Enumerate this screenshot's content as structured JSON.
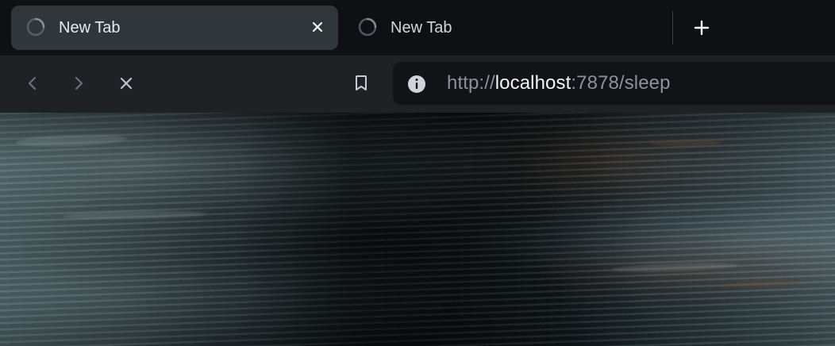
{
  "tabs": [
    {
      "title": "New Tab",
      "state": "active",
      "loading": true
    },
    {
      "title": "New Tab",
      "state": "inactive",
      "loading": true
    }
  ],
  "toolbar": {
    "address": {
      "scheme": "http://",
      "host": "localhost",
      "rest": ":7878/sleep"
    }
  },
  "icons": {
    "tab_loading": "spinner-icon",
    "tab_close": "close-icon",
    "new_tab": "plus-icon",
    "back": "chevron-left-icon",
    "forward": "chevron-right-icon",
    "stop": "close-icon",
    "bookmark": "bookmark-icon",
    "site_info": "info-icon"
  },
  "colors": {
    "tabstrip_background": "#0f1014",
    "active_tab_background": "#30363a",
    "toolbar_background": "#202125",
    "address_bar_background": "#121316",
    "text_primary": "#e8eaed",
    "text_secondary": "#8d9299"
  }
}
